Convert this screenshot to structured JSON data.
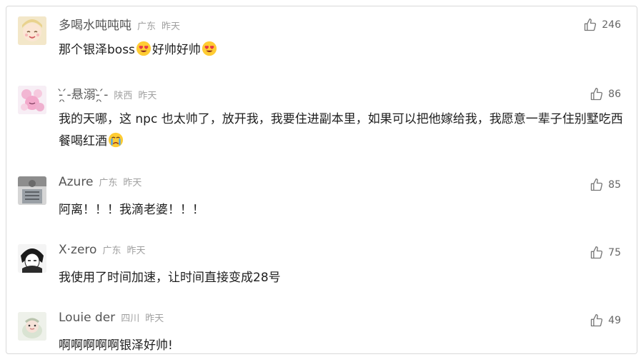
{
  "comments": [
    {
      "username": "多喝水吨吨吨",
      "region": "广东",
      "time": "昨天",
      "likes": "246",
      "text_a": "那个银泽boss",
      "text_b": "好帅好帅",
      "emojis": [
        "heart-eyes-emoji",
        "heart-eyes-emoji"
      ]
    },
    {
      "username": "-̗̀ ̖́-悬溺-̗̀ ̖́-",
      "region": "陕西",
      "time": "昨天",
      "likes": "86",
      "text": "我的天哪，这 npc 也太帅了，放开我，我要住进副本里，如果可以把他嫁给我，我愿意一辈子住别墅吃西餐喝红酒",
      "emojis": [
        "crying-emoji"
      ]
    },
    {
      "username": "Azure",
      "region": "广东",
      "time": "昨天",
      "likes": "85",
      "text": "阿离！！！我滴老婆！！！"
    },
    {
      "username": "X·zero",
      "region": "广东",
      "time": "昨天",
      "likes": "75",
      "text": "我使用了时间加速，让时间直接变成28号"
    },
    {
      "username": "Louie der",
      "region": "四川",
      "time": "昨天",
      "likes": "49",
      "text": "啊啊啊啊啊银泽好帅!"
    }
  ],
  "icons": {
    "like": "thumbs-up-icon"
  },
  "colors": {
    "username": "#555555",
    "meta": "#a0a0a0",
    "text": "#1e1e1e",
    "border": "#d9d9d9"
  }
}
